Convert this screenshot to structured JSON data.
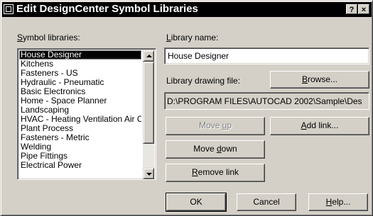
{
  "window": {
    "title": "Edit DesignCenter Symbol Libraries",
    "help_button": "?",
    "close_button": "×"
  },
  "symbol_libraries": {
    "label_mnemonic": "S",
    "label_rest": "ymbol libraries:",
    "items": [
      "House Designer",
      "Kitchens",
      "Fasteners - US",
      "Hydraulic - Pneumatic",
      "Basic Electronics",
      "Home - Space Planner",
      "Landscaping",
      "HVAC - Heating Ventilation Air C",
      "Plant Process",
      "Fasteners - Metric",
      "Welding",
      "Pipe Fittings",
      "Electrical Power"
    ],
    "selected_index": 0
  },
  "library_name": {
    "label_mnemonic": "L",
    "label_rest": "ibrary name:",
    "value": "House Designer"
  },
  "library_drawing_file": {
    "label": "Library drawing file:",
    "path": "D:\\PROGRAM FILES\\AUTOCAD 2002\\Sample\\Des"
  },
  "buttons": {
    "browse": {
      "mnemonic": "B",
      "rest": "rowse..."
    },
    "move_up": {
      "before": "Move ",
      "mnemonic": "u",
      "after": "p"
    },
    "add_link": {
      "mnemonic": "A",
      "rest": "dd link..."
    },
    "move_down": {
      "before": "Move ",
      "mnemonic": "d",
      "after": "own"
    },
    "remove_link": {
      "mnemonic": "R",
      "rest": "emove link"
    },
    "ok": "OK",
    "cancel": "Cancel",
    "help": {
      "mnemonic": "H",
      "rest": "elp..."
    }
  }
}
